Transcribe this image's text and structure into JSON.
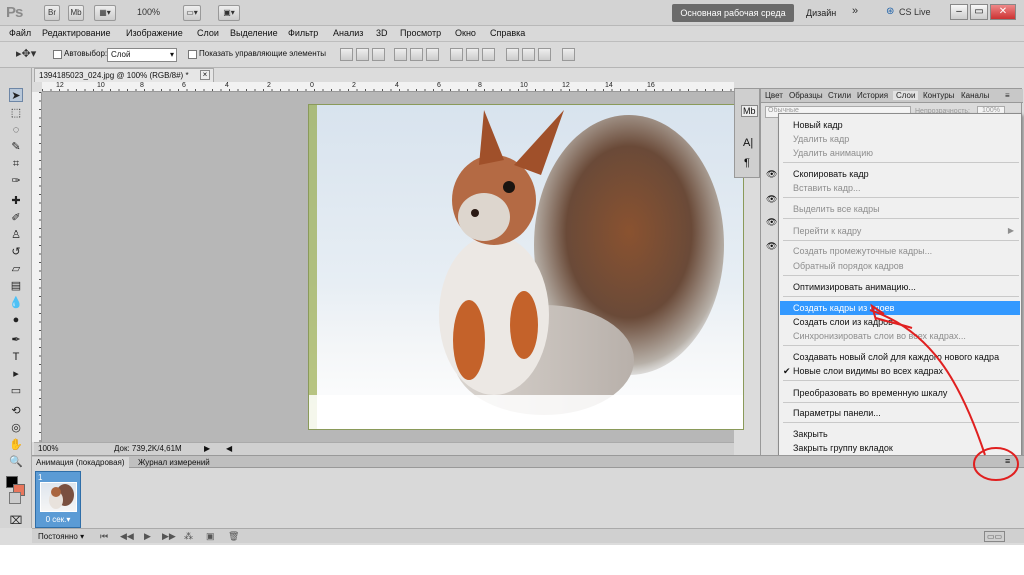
{
  "titlebar": {
    "logo": "Ps",
    "bridge": "Br",
    "minibridge": "Mb",
    "zoom": "100%",
    "workspace_main": "Основная рабочая среда",
    "workspace_design": "Дизайн",
    "more": "»",
    "cs_live": "CS Live"
  },
  "menu": [
    "Файл",
    "Редактирование",
    "Изображение",
    "Слои",
    "Выделение",
    "Фильтр",
    "Анализ",
    "3D",
    "Просмотр",
    "Окно",
    "Справка"
  ],
  "options": {
    "autoselect_label": "Автовыбор:",
    "autoselect_value": "Слой",
    "show_transform_label": "Показать управляющие элементы"
  },
  "document": {
    "tab_title": "1394185023_024.jpg @ 100% (RGB/8#) *",
    "close": "×",
    "zoom": "100%",
    "doc_info": "Док: 739,2K/4,61M",
    "ruler_numbers": [
      "12",
      "10",
      "8",
      "6",
      "4",
      "2",
      "0",
      "2",
      "4",
      "6",
      "8",
      "10",
      "12",
      "14",
      "16"
    ]
  },
  "layers_panel": {
    "tabs": [
      "Цвет",
      "Образцы",
      "Стили",
      "История",
      "Слои",
      "Контуры",
      "Каналы"
    ],
    "mode": "Обычные",
    "opacity_label": "Непрозрачность:",
    "opacity_value": "100%"
  },
  "context_menu": {
    "items": [
      {
        "label": "Новый кадр",
        "disabled": false
      },
      {
        "label": "Удалить кадр",
        "disabled": true
      },
      {
        "label": "Удалить анимацию",
        "disabled": true
      },
      {
        "label": "Скопировать кадр",
        "disabled": false
      },
      {
        "label": "Вставить кадр...",
        "disabled": true
      },
      {
        "label": "Выделить все кадры",
        "disabled": true
      },
      {
        "label": "Перейти к кадру",
        "disabled": true
      },
      {
        "label": "Создать промежуточные кадры...",
        "disabled": true
      },
      {
        "label": "Обратный порядок кадров",
        "disabled": true
      },
      {
        "label": "Оптимизировать анимацию...",
        "disabled": false
      },
      {
        "label": "Создать кадры из слоев",
        "disabled": false,
        "highlighted": true
      },
      {
        "label": "Создать слои из кадров",
        "disabled": false
      },
      {
        "label": "Синхронизировать слои во всех кадрах...",
        "disabled": true
      },
      {
        "label": "Создавать новый слой для каждого нового кадра",
        "disabled": false
      },
      {
        "label": "Новые слои видимы во всех кадрах",
        "disabled": false,
        "checked": true
      },
      {
        "label": "Преобразовать во временную шкалу",
        "disabled": false
      },
      {
        "label": "Параметры панели...",
        "disabled": false
      },
      {
        "label": "Закрыть",
        "disabled": false
      },
      {
        "label": "Закрыть группу вкладок",
        "disabled": false
      }
    ],
    "checkmark": "✔",
    "submenu_arrow": "▶"
  },
  "animation_panel": {
    "tab_animation": "Анимация (покадровая)",
    "tab_measurement": "Журнал измерений",
    "frame_number": "1",
    "frame_time": "0 сек.",
    "loop": "Постоянно"
  },
  "colors": {
    "highlight": "#3399ff",
    "annotation": "#e02020",
    "frame_selected": "#5b9bd5"
  }
}
